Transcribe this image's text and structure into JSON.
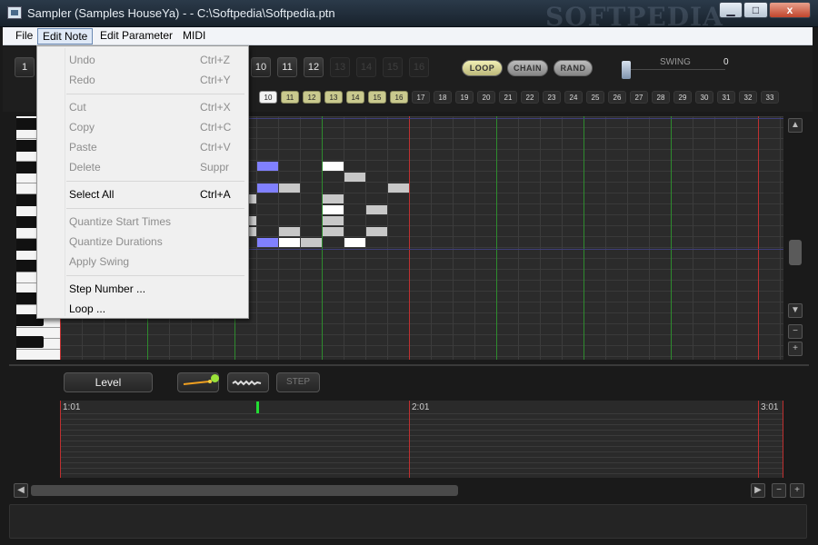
{
  "window": {
    "title": "Sampler (Samples HouseYa) - -   C:\\Softpedia\\Softpedia.ptn",
    "watermark": "SOFTPEDIA",
    "minimize_glyph": "▁",
    "maximize_glyph": "□",
    "close_glyph": "x"
  },
  "menubar": [
    "File",
    "Edit Note",
    "Edit Parameter",
    "MIDI"
  ],
  "edit_menu": {
    "items": [
      {
        "label": "Undo",
        "shortcut": "Ctrl+Z",
        "enabled": false
      },
      {
        "label": "Redo",
        "shortcut": "Ctrl+Y",
        "enabled": false
      },
      {
        "label": "Cut",
        "shortcut": "Ctrl+X",
        "enabled": false
      },
      {
        "label": "Copy",
        "shortcut": "Ctrl+C",
        "enabled": false
      },
      {
        "label": "Paste",
        "shortcut": "Ctrl+V",
        "enabled": false
      },
      {
        "label": "Delete",
        "shortcut": "Suppr",
        "enabled": false
      },
      {
        "label": "Select All",
        "shortcut": "Ctrl+A",
        "enabled": true
      },
      {
        "label": "Quantize Start Times",
        "shortcut": "",
        "enabled": false
      },
      {
        "label": "Quantize Durations",
        "shortcut": "",
        "enabled": false
      },
      {
        "label": "Apply Swing",
        "shortcut": "",
        "enabled": false
      },
      {
        "label": "Step Number ...",
        "shortcut": "",
        "enabled": true
      },
      {
        "label": "Loop ...",
        "shortcut": "",
        "enabled": true
      }
    ]
  },
  "patterns": {
    "first": "1",
    "visible": [
      "10",
      "11",
      "12",
      "13",
      "14",
      "15",
      "16"
    ],
    "enabled_up_to": "12"
  },
  "modes": {
    "loop": "LOOP",
    "chain": "CHAIN",
    "rand": "RAND",
    "loop_active": true
  },
  "swing": {
    "label": "SWING",
    "value": "0"
  },
  "steps": {
    "visible": [
      "10",
      "11",
      "12",
      "13",
      "14",
      "15",
      "16",
      "17",
      "18",
      "19",
      "20",
      "21",
      "22",
      "23",
      "24",
      "25",
      "26",
      "27",
      "28",
      "29",
      "30",
      "31",
      "32",
      "33"
    ],
    "current": "10",
    "active_through": "16"
  },
  "notes": [
    {
      "step": 10,
      "row": 4,
      "color": "blue"
    },
    {
      "step": 13,
      "row": 4,
      "color": "white"
    },
    {
      "step": 14,
      "row": 5,
      "color": "gray"
    },
    {
      "step": 10,
      "row": 6,
      "color": "blue"
    },
    {
      "step": 11,
      "row": 6,
      "color": "gray"
    },
    {
      "step": 16,
      "row": 6,
      "color": "gray"
    },
    {
      "step": 9,
      "row": 7,
      "color": "gray"
    },
    {
      "step": 13,
      "row": 7,
      "color": "gray"
    },
    {
      "step": 13,
      "row": 8,
      "color": "white"
    },
    {
      "step": 15,
      "row": 8,
      "color": "gray"
    },
    {
      "step": 9,
      "row": 9,
      "color": "gray"
    },
    {
      "step": 13,
      "row": 9,
      "color": "gray"
    },
    {
      "step": 9,
      "row": 10,
      "color": "gray"
    },
    {
      "step": 11,
      "row": 10,
      "color": "gray"
    },
    {
      "step": 13,
      "row": 10,
      "color": "gray"
    },
    {
      "step": 15,
      "row": 10,
      "color": "gray"
    },
    {
      "step": 10,
      "row": 11,
      "color": "blue"
    },
    {
      "step": 11,
      "row": 11,
      "color": "white"
    },
    {
      "step": 12,
      "row": 11,
      "color": "gray"
    },
    {
      "step": 14,
      "row": 11,
      "color": "white"
    }
  ],
  "parameter": {
    "name": "Level",
    "step_label": "STEP",
    "led_color": "#9be33a"
  },
  "timeline": {
    "markers": [
      "1:01",
      "2:01",
      "3:01"
    ],
    "playhead_color": "#22dd33"
  },
  "colors": {
    "note_blue": "#8080ff",
    "loop_on": "#e8e6a8",
    "step_on": "#c9c98e",
    "bar_line": "#c03030",
    "beat_line": "#2e8b2e"
  },
  "icons": {
    "scroll_up": "▲",
    "scroll_down": "▼",
    "scroll_left": "◀",
    "scroll_right": "▶",
    "zoom_out": "−",
    "zoom_in": "+"
  }
}
